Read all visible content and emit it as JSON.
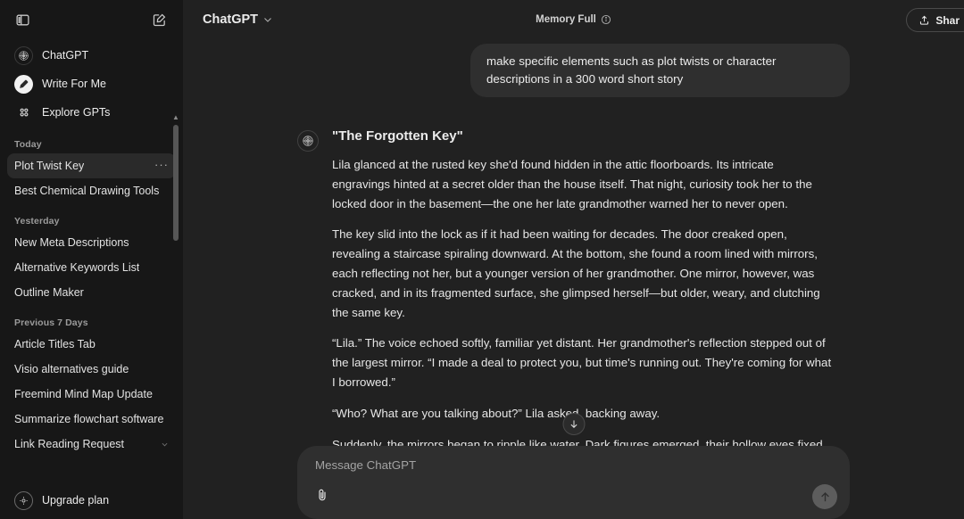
{
  "sidebar": {
    "toggle_icon": "sidebar-toggle-icon",
    "new_chat_icon": "new-chat-icon",
    "nav": [
      {
        "label": "ChatGPT",
        "icon": "chatgpt-logo-icon"
      },
      {
        "label": "Write For Me",
        "icon": "pencil-circle-icon"
      },
      {
        "label": "Explore GPTs",
        "icon": "grid-dots-icon"
      }
    ],
    "sections": [
      {
        "heading": "Today",
        "items": [
          {
            "title": "Plot Twist Key",
            "active": true,
            "menu": "···"
          },
          {
            "title": "Best Chemical Drawing Tools",
            "active": false
          }
        ]
      },
      {
        "heading": "Yesterday",
        "items": [
          {
            "title": "New Meta Descriptions",
            "active": false
          },
          {
            "title": "Alternative Keywords List",
            "active": false
          },
          {
            "title": "Outline Maker",
            "active": false
          }
        ]
      },
      {
        "heading": "Previous 7 Days",
        "items": [
          {
            "title": "Article Titles Tab",
            "active": false
          },
          {
            "title": "Visio alternatives guide",
            "active": false
          },
          {
            "title": "Freemind Mind Map Update",
            "active": false
          },
          {
            "title": "Summarize flowchart software",
            "active": false
          },
          {
            "title": "Link Reading Request",
            "active": false,
            "chevron": true
          }
        ]
      }
    ],
    "upgrade": {
      "label": "Upgrade plan",
      "icon": "upgrade-sparkle-icon"
    }
  },
  "header": {
    "model": "ChatGPT",
    "model_chevron_icon": "chevron-down-icon",
    "memory_status": "Memory Full",
    "memory_info_icon": "info-circle-icon",
    "share_label": "Shar",
    "share_icon": "share-upload-icon"
  },
  "conversation": {
    "user_message": "make specific elements such as plot twists or character descriptions in a 300 word short story",
    "assistant": {
      "avatar_icon": "chatgpt-logo-icon",
      "title": "\"The Forgotten Key\"",
      "paragraphs": [
        "Lila glanced at the rusted key she'd found hidden in the attic floorboards. Its intricate engravings hinted at a secret older than the house itself. That night, curiosity took her to the locked door in the basement—the one her late grandmother warned her to never open.",
        "The key slid into the lock as if it had been waiting for decades. The door creaked open, revealing a staircase spiraling downward. At the bottom, she found a room lined with mirrors, each reflecting not her, but a younger version of her grandmother. One mirror, however, was cracked, and in its fragmented surface, she glimpsed herself—but older, weary, and clutching the same key.",
        "“Lila.” The voice echoed softly, familiar yet distant. Her grandmother's reflection stepped out of the largest mirror. “I made a deal to protect you, but time's running out. They're coming for what I borrowed.”",
        "“Who? What are you talking about?” Lila asked, backing away.",
        "Suddenly, the mirrors began to ripple like water. Dark figures emerged, their hollow eyes fixed on her. Her grandmother thrust the key back into Lila's hands. “Run, and whatever you do, don't lock the door behind you!”"
      ]
    },
    "scroll_down_icon": "arrow-down-icon"
  },
  "composer": {
    "placeholder": "Message ChatGPT",
    "attach_icon": "paperclip-icon",
    "send_icon": "arrow-up-icon"
  },
  "colors": {
    "sidebar_bg": "#171717",
    "main_bg": "#212121",
    "bubble_bg": "#2f2f2f",
    "active_item": "#2a2a2a",
    "text_primary": "#ececec",
    "text_muted": "#9b9b9b",
    "send_btn": "#5d5d5d"
  }
}
